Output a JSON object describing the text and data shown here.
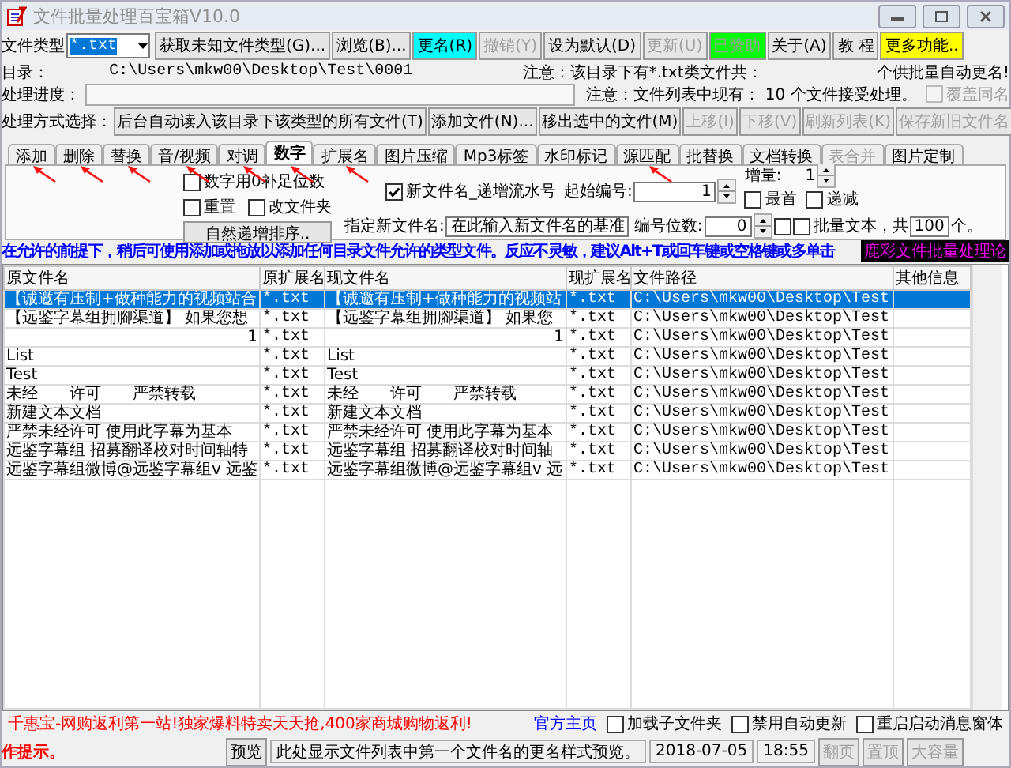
{
  "window": {
    "title": "文件批量处理百宝箱V10.0"
  },
  "toolbar": {
    "file_type_label": "文件类型",
    "file_type": "*.txt",
    "buttons": [
      {
        "label": "获取未知文件类型(G)...",
        "disabled": false
      },
      {
        "label": "浏览(B)...",
        "disabled": false
      },
      {
        "label": "更名(R)",
        "disabled": false,
        "color": "#00ffff"
      },
      {
        "label": "撤销(Y)",
        "disabled": true
      },
      {
        "label": "设为默认(D)",
        "disabled": false
      },
      {
        "label": "更新(U)",
        "disabled": true
      },
      {
        "label": "已赞助",
        "disabled": true,
        "color": "#00ff00"
      },
      {
        "label": "关于(A)",
        "disabled": false
      },
      {
        "label": "教 程",
        "disabled": false
      },
      {
        "label": "更多功能..",
        "disabled": false,
        "color": "#ffff00"
      }
    ]
  },
  "directory": {
    "label": "目录：",
    "path": "C:\\Users\\mkw00\\Desktop\\Test\\0001",
    "note": "注意：该目录下有*.txt类文件共：",
    "auto_note": "个供批量自动更名!"
  },
  "progress": {
    "label": "处理进度：",
    "note": "注意：文件列表中现有：  10 个文件接受处理。",
    "overwrite": {
      "label": "覆盖同名",
      "checked": false,
      "disabled": true
    }
  },
  "mode": {
    "label": "处理方式选择：",
    "buttons": [
      {
        "label": "后台自动读入该目录下该类型的所有文件(T)",
        "disabled": false
      },
      {
        "label": "添加文件(N)...",
        "disabled": false
      },
      {
        "label": "移出选中的文件(M)",
        "disabled": false
      },
      {
        "label": "上移(I)",
        "disabled": true
      },
      {
        "label": "下移(V)",
        "disabled": true
      },
      {
        "label": "刷新列表(K)",
        "disabled": true
      },
      {
        "label": "保存新旧文件名",
        "disabled": true
      }
    ]
  },
  "tabs": [
    {
      "label": "添加",
      "selected": false,
      "disabled": false,
      "annotated": true
    },
    {
      "label": "删除",
      "selected": false,
      "disabled": false,
      "annotated": true
    },
    {
      "label": "替换",
      "selected": false,
      "disabled": false,
      "annotated": true
    },
    {
      "label": "音/视频",
      "selected": false,
      "disabled": false,
      "annotated": true
    },
    {
      "label": "对调",
      "selected": false,
      "disabled": false,
      "annotated": true
    },
    {
      "label": "数字",
      "selected": true,
      "disabled": false,
      "annotated": true
    },
    {
      "label": "扩展名",
      "selected": false,
      "disabled": false,
      "annotated": true
    },
    {
      "label": "图片压缩",
      "selected": false,
      "disabled": false,
      "annotated": false
    },
    {
      "label": "Mp3标签",
      "selected": false,
      "disabled": false,
      "annotated": false
    },
    {
      "label": "水印标记",
      "selected": false,
      "disabled": false,
      "annotated": false
    },
    {
      "label": "源匹配",
      "selected": false,
      "disabled": false,
      "annotated": true
    },
    {
      "label": "批替换",
      "selected": false,
      "disabled": false,
      "annotated": false
    },
    {
      "label": "文档转换",
      "selected": false,
      "disabled": false,
      "annotated": false
    },
    {
      "label": "表合并",
      "selected": false,
      "disabled": true,
      "annotated": false
    },
    {
      "label": "图片定制",
      "selected": false,
      "disabled": false,
      "annotated": false
    }
  ],
  "panel": {
    "pad_zeros": {
      "label": "数字用0补足位数",
      "checked": false
    },
    "reset": {
      "label": "重置",
      "checked": false
    },
    "change_folder": {
      "label": "改文件夹",
      "checked": false
    },
    "sort_button": "自然递增排序..",
    "serial": {
      "label": "新文件名_递增流水号",
      "checked": true
    },
    "start_label": "起始编号:",
    "start_value": "1",
    "increment_label": "增量:",
    "increment_value": "1",
    "first": {
      "label": "最首",
      "checked": false
    },
    "descending": {
      "label": "递减",
      "checked": false
    },
    "new_name_label": "指定新文件名:",
    "new_name_value": "在此输入新文件名的基准",
    "digits_label": "编号位数:",
    "digits_value": "0",
    "digits_check": {
      "checked": false
    },
    "batch_text": {
      "label": "批量文本，共",
      "checked": false
    },
    "batch_count": "100",
    "batch_unit": "个。"
  },
  "marquee": "在允许的前提下，稍后可使用添加或拖放以添加任何目录文件允许的类型文件。反应不灵敏，建议Alt+T或回车键或空格键或多单击",
  "forum_banner": "鹿彩文件批量处理论",
  "table": {
    "columns": [
      "原文件名",
      "原扩展名",
      "现文件名",
      "现扩展名",
      "文件路径",
      "其他信息"
    ],
    "rows": [
      {
        "original_name": "【诚邀有压制+做种能力的视频站合",
        "original_ext": "*.txt",
        "new_name": "【诚邀有压制+做种能力的视频站",
        "new_ext": "*.txt",
        "path": "C:\\Users\\mkw00\\Desktop\\Test",
        "selected": true
      },
      {
        "original_name": "【远鉴字幕组拥腳渠道】 如果您想",
        "original_ext": "*.txt",
        "new_name": "【远鉴字幕组拥腳渠道】 如果您",
        "new_ext": "*.txt",
        "path": "C:\\Users\\mkw00\\Desktop\\Test",
        "selected": false
      },
      {
        "original_name": "1",
        "original_ext": "*.txt",
        "new_name": "1",
        "new_ext": "*.txt",
        "path": "C:\\Users\\mkw00\\Desktop\\Test",
        "selected": false
      },
      {
        "original_name": "List",
        "original_ext": "*.txt",
        "new_name": "List",
        "new_ext": "*.txt",
        "path": "C:\\Users\\mkw00\\Desktop\\Test",
        "selected": false
      },
      {
        "original_name": "Test",
        "original_ext": "*.txt",
        "new_name": "Test",
        "new_ext": "*.txt",
        "path": "C:\\Users\\mkw00\\Desktop\\Test",
        "selected": false
      },
      {
        "original_name": "未经　　许可　　严禁转载",
        "original_ext": "*.txt",
        "new_name": "未经　　许可　　严禁转载",
        "new_ext": "*.txt",
        "path": "C:\\Users\\mkw00\\Desktop\\Test",
        "selected": false
      },
      {
        "original_name": "新建文本文档",
        "original_ext": "*.txt",
        "new_name": "新建文本文档",
        "new_ext": "*.txt",
        "path": "C:\\Users\\mkw00\\Desktop\\Test",
        "selected": false
      },
      {
        "original_name": "严禁未经许可 使用此字幕为基本",
        "original_ext": "*.txt",
        "new_name": "严禁未经许可 使用此字幕为基本",
        "new_ext": "*.txt",
        "path": "C:\\Users\\mkw00\\Desktop\\Test",
        "selected": false
      },
      {
        "original_name": "远鉴字幕组 招募翻译校对时间轴特",
        "original_ext": "*.txt",
        "new_name": "远鉴字幕组 招募翻译校对时间轴",
        "new_ext": "*.txt",
        "path": "C:\\Users\\mkw00\\Desktop\\Test",
        "selected": false
      },
      {
        "original_name": "远鉴字幕组微博@远鉴字幕组v 远鉴",
        "original_ext": "*.txt",
        "new_name": "远鉴字幕组微博@远鉴字幕组v 远",
        "new_ext": "*.txt",
        "path": "C:\\Users\\mkw00\\Desktop\\Test",
        "selected": false
      }
    ]
  },
  "footer": {
    "ad": "千惠宝-网购返利第一站!独家爆料特卖天天抢,400家商城购物返利!",
    "homepage": "官方主页",
    "options": [
      {
        "label": "加载子文件夹",
        "checked": false
      },
      {
        "label": "禁用自动更新",
        "checked": false
      },
      {
        "label": "重启启动消息窗体",
        "checked": false
      }
    ]
  },
  "status_bar": {
    "hint": "作提示。",
    "preview_button": "预览",
    "preview_text": "此处显示文件列表中第一个文件名的更名样式预览。",
    "date": "2018-07-05",
    "time": "18:55",
    "buttons": [
      {
        "label": "翻页",
        "disabled": true
      },
      {
        "label": "置顶",
        "disabled": true
      },
      {
        "label": "大容量",
        "disabled": true
      }
    ]
  }
}
